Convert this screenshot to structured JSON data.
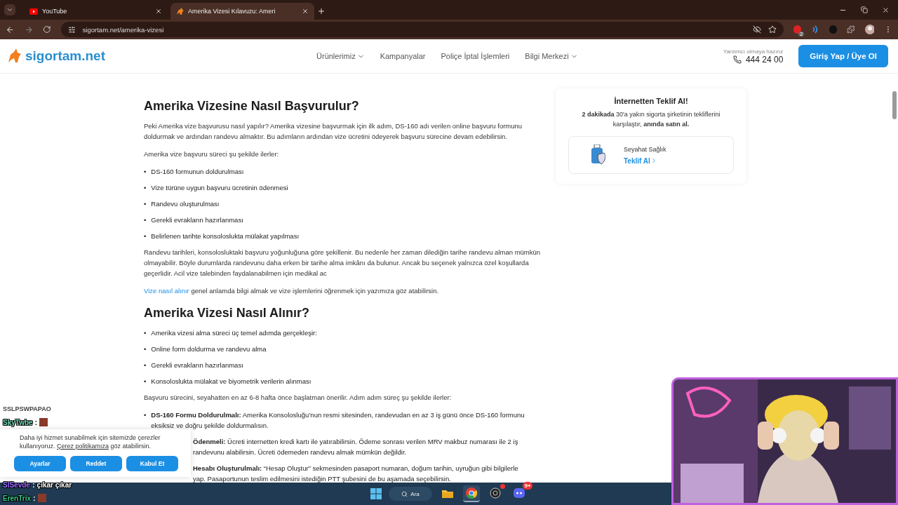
{
  "browser": {
    "tabs": [
      {
        "title": "YouTube",
        "kind": "video",
        "selected": false
      },
      {
        "title": "Amerika Vizesi Kılavuzu: Ameri",
        "kind": "site",
        "selected": true
      }
    ],
    "url": "sigortam.net/amerika-vizesi",
    "extension_badge": "2"
  },
  "site": {
    "logo": "sigortam.net",
    "nav": [
      {
        "label": "Ürünlerimiz",
        "dropdown": true
      },
      {
        "label": "Kampanyalar",
        "dropdown": false
      },
      {
        "label": "Poliçe İptal İşlemleri",
        "dropdown": false
      },
      {
        "label": "Bilgi Merkezi",
        "dropdown": true
      }
    ],
    "help_text": "Yardımcı olmaya hazırız",
    "phone": "444 24 00",
    "login_button": "Giriş Yap / Üye Ol"
  },
  "article": {
    "sections": [
      {
        "heading": "Amerika Vizesine Nasıl Başvurulur?",
        "blocks": [
          {
            "kind": "paragraph",
            "text": "Peki Amerika vize başvurusu nasıl yapılır? Amerika vizesine başvurmak için ilk adım, DS-160 adı verilen online başvuru formunu doldurmak ve ardından randevu almaktır. Bu adımların ardından vize ücretini ödeyerek başvuru sürecine devam edebilirsin."
          },
          {
            "kind": "paragraph",
            "text": "Amerika vize başvuru süreci şu şekilde ilerler:"
          },
          {
            "kind": "list",
            "marker": "•",
            "items": [
              "DS-160 formunun doldurulması",
              "Vize türüne uygun başvuru ücretinin ödenmesi",
              "Randevu oluşturulması",
              "Gerekli evrakların hazırlanması",
              "Belirlenen tarihte konsoloslukta mülakat yapılması"
            ]
          },
          {
            "kind": "paragraph",
            "text": "Randevu tarihleri, konsolosluktaki başvuru yoğunluğuna göre şekillenir. Bu nedenle her zaman dilediğin tarihe randevu alman mümkün olmayabilir. Böyle durumlarda randevunu daha erken bir tarihe alma imkânı da bulunur. Ancak bu seçenek yalnızca özel koşullarda geçerlidir. Acil vize talebinden faydalanabilmen için medikal ac"
          },
          {
            "kind": "link_paragraph",
            "link": "Vize nasıl alınır",
            "text": "genel anlamda bilgi almak ve vize işlemlerini öğrenmek için yazımıza göz atabilirsin."
          }
        ]
      },
      {
        "heading": "Amerika Vizesi Nasıl Alınır?",
        "blocks": [
          {
            "kind": "list",
            "marker": "•",
            "items": [
              "Amerika vizesi alma süreci üç temel adımda gerçekleşir:",
              "Online form doldurma ve randevu alma",
              "Gerekli evrakların hazırlanması",
              "Konsoloslukta mülakat ve biyometrik verilerin alınması"
            ]
          },
          {
            "kind": "paragraph",
            "text": "Başvuru sürecini, seyahatten en az 6-8 hafta önce başlatman önerilir. Adım adım süreç şu şekilde ilerler:"
          },
          {
            "kind": "steps",
            "marker": "•",
            "items": [
              {
                "kind": "full",
                "text": "**DS-160 Formu Doldurulmalı:** Amerika Konsolosluğu’nun resmi sitesinden, randevudan en az 3 iş günü önce DS-160 formunu eksiksiz ve doğru şekilde doldurmalısın."
              },
              {
                "kind": "partial",
                "lines": [
                  "**Ödenmeli:** Ücreti internetten kredi kartı ile yatırabilirsin. Ödeme sonrası verilen MRV makbuz numarası ile 2 iş",
                  "randevunu alabilirsin. Ücreti ödemeden randevu almak mümkün değildir."
                ]
              },
              {
                "kind": "partial",
                "lines": [
                  "**Hesabı Oluşturulmalı:** “Hesap Oluştur” sekmesinden pasaport numaran, doğum tarihin, uyruğun gibi bilgilerle",
                  "yap. Pasaportunun teslim edilmesini istediğin PTT şubesini de bu aşamada seçebilirsin."
                ]
              }
            ]
          }
        ]
      }
    ]
  },
  "sidebar": {
    "title": "İnternetten Teklif Al!",
    "description": "**2 dakikada** 30'a yakın sigorta şirketinin tekliflerini karşılaştır, **anında satın al.**",
    "product": {
      "name": "Seyahat Sağlık",
      "link": "Teklif Al"
    }
  },
  "cookie_banner": {
    "text_before": "Daha iyi hizmet sunabilmek için sitemizde çerezler kullanıyoruz.",
    "link": "Çerez politikamıza",
    "text_after": "göz atabilirsin.",
    "buttons": [
      "Ayarlar",
      "Reddet",
      "Kabul Et"
    ]
  },
  "chat": [
    {
      "kind": "text",
      "text": "SSLPSWPAPAO"
    },
    {
      "kind": "message",
      "user": "SkyTwbe",
      "separator": ":",
      "color": "#6fd6b0",
      "emote": true
    },
    {
      "kind": "message",
      "user": "SlSevde",
      "separator": ":",
      "message": "çıkar çıkar",
      "color": "#9b6cff",
      "emote": false
    },
    {
      "kind": "message",
      "user": "ErenTrix",
      "separator": ":",
      "color": "#3cc98a",
      "emote": true
    }
  ],
  "taskbar": {
    "search": "Ara",
    "apps": [
      {
        "kind": "folder",
        "selected": false
      },
      {
        "kind": "browser",
        "selected": true
      },
      {
        "kind": "recorder",
        "selected": false,
        "alert": true
      },
      {
        "kind": "chat",
        "selected": false,
        "badge": "9+"
      }
    ]
  }
}
